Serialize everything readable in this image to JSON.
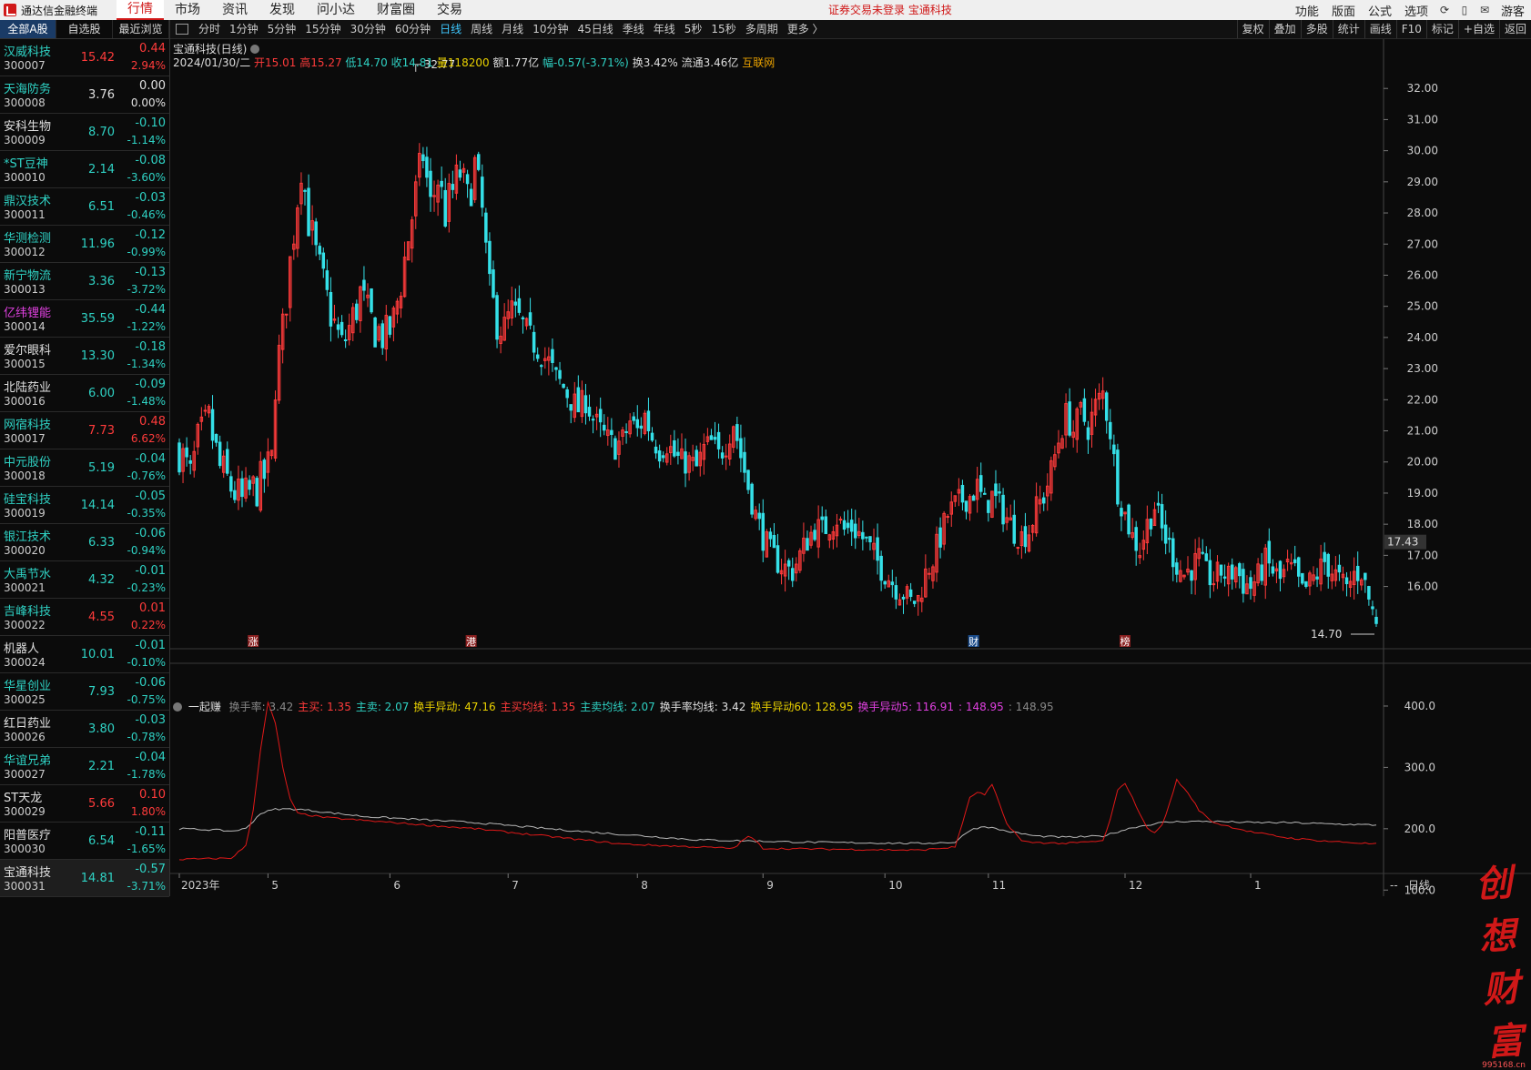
{
  "app": {
    "name": "通达信金融终端"
  },
  "menu": [
    "行情",
    "市场",
    "资讯",
    "发现",
    "问小达",
    "财富圈",
    "交易"
  ],
  "menu_active": 0,
  "notice": "证券交易未登录  宝通科技",
  "right_menu": [
    "功能",
    "版面",
    "公式",
    "选项"
  ],
  "right_icons": [
    "sync-icon",
    "phone-icon",
    "mail-icon"
  ],
  "guest": "游客",
  "left_tabs": [
    "全部A股",
    "自选股",
    "最近浏览"
  ],
  "stocks": [
    {
      "name": "汉威科技",
      "code": "300007",
      "price": "15.42",
      "chg": "0.44",
      "pct": "2.94%",
      "dir": "up",
      "ncolor": "#2fd2c4"
    },
    {
      "name": "天海防务",
      "code": "300008",
      "price": "3.76",
      "chg": "0.00",
      "pct": "0.00%",
      "dir": "fl",
      "ncolor": "#2fd2c4"
    },
    {
      "name": "安科生物",
      "code": "300009",
      "price": "8.70",
      "chg": "-0.10",
      "pct": "-1.14%",
      "dir": "dn",
      "ncolor": "#e0e0e0"
    },
    {
      "name": "*ST豆神",
      "code": "300010",
      "price": "2.14",
      "chg": "-0.08",
      "pct": "-3.60%",
      "dir": "dn",
      "ncolor": "#2fd2c4"
    },
    {
      "name": "鼎汉技术",
      "code": "300011",
      "price": "6.51",
      "chg": "-0.03",
      "pct": "-0.46%",
      "dir": "dn",
      "ncolor": "#2fd2c4"
    },
    {
      "name": "华测检测",
      "code": "300012",
      "price": "11.96",
      "chg": "-0.12",
      "pct": "-0.99%",
      "dir": "dn",
      "ncolor": "#2fd2c4"
    },
    {
      "name": "新宁物流",
      "code": "300013",
      "price": "3.36",
      "chg": "-0.13",
      "pct": "-3.72%",
      "dir": "dn",
      "ncolor": "#2fd2c4"
    },
    {
      "name": "亿纬锂能",
      "code": "300014",
      "price": "35.59",
      "chg": "-0.44",
      "pct": "-1.22%",
      "dir": "dn",
      "ncolor": "#e040e0"
    },
    {
      "name": "爱尔眼科",
      "code": "300015",
      "price": "13.30",
      "chg": "-0.18",
      "pct": "-1.34%",
      "dir": "dn",
      "ncolor": "#e0e0e0"
    },
    {
      "name": "北陆药业",
      "code": "300016",
      "price": "6.00",
      "chg": "-0.09",
      "pct": "-1.48%",
      "dir": "dn",
      "ncolor": "#e0e0e0"
    },
    {
      "name": "网宿科技",
      "code": "300017",
      "price": "7.73",
      "chg": "0.48",
      "pct": "6.62%",
      "dir": "up",
      "ncolor": "#2fd2c4"
    },
    {
      "name": "中元股份",
      "code": "300018",
      "price": "5.19",
      "chg": "-0.04",
      "pct": "-0.76%",
      "dir": "dn",
      "ncolor": "#2fd2c4"
    },
    {
      "name": "硅宝科技",
      "code": "300019",
      "price": "14.14",
      "chg": "-0.05",
      "pct": "-0.35%",
      "dir": "dn",
      "ncolor": "#2fd2c4"
    },
    {
      "name": "银江技术",
      "code": "300020",
      "price": "6.33",
      "chg": "-0.06",
      "pct": "-0.94%",
      "dir": "dn",
      "ncolor": "#2fd2c4"
    },
    {
      "name": "大禹节水",
      "code": "300021",
      "price": "4.32",
      "chg": "-0.01",
      "pct": "-0.23%",
      "dir": "dn",
      "ncolor": "#2fd2c4"
    },
    {
      "name": "吉峰科技",
      "code": "300022",
      "price": "4.55",
      "chg": "0.01",
      "pct": "0.22%",
      "dir": "up",
      "ncolor": "#2fd2c4"
    },
    {
      "name": "机器人",
      "code": "300024",
      "price": "10.01",
      "chg": "-0.01",
      "pct": "-0.10%",
      "dir": "dn",
      "ncolor": "#e0e0e0"
    },
    {
      "name": "华星创业",
      "code": "300025",
      "price": "7.93",
      "chg": "-0.06",
      "pct": "-0.75%",
      "dir": "dn",
      "ncolor": "#2fd2c4"
    },
    {
      "name": "红日药业",
      "code": "300026",
      "price": "3.80",
      "chg": "-0.03",
      "pct": "-0.78%",
      "dir": "dn",
      "ncolor": "#e0e0e0"
    },
    {
      "name": "华谊兄弟",
      "code": "300027",
      "price": "2.21",
      "chg": "-0.04",
      "pct": "-1.78%",
      "dir": "dn",
      "ncolor": "#2fd2c4"
    },
    {
      "name": "ST天龙",
      "code": "300029",
      "price": "5.66",
      "chg": "0.10",
      "pct": "1.80%",
      "dir": "up",
      "ncolor": "#e0e0e0"
    },
    {
      "name": "阳普医疗",
      "code": "300030",
      "price": "6.54",
      "chg": "-0.11",
      "pct": "-1.65%",
      "dir": "dn",
      "ncolor": "#e0e0e0"
    },
    {
      "name": "宝通科技",
      "code": "300031",
      "price": "14.81",
      "chg": "-0.57",
      "pct": "-3.71%",
      "dir": "dn",
      "ncolor": "#e0e0e0",
      "sel": true
    }
  ],
  "toolbar_left": [
    "分时",
    "1分钟",
    "5分钟",
    "15分钟",
    "30分钟",
    "60分钟",
    "日线",
    "周线",
    "月线",
    "10分钟",
    "45日线",
    "季线",
    "年线",
    "5秒",
    "15秒",
    "多周期",
    "更多 〉"
  ],
  "toolbar_active": "日线",
  "toolbar_right": [
    "复权",
    "叠加",
    "多股",
    "统计",
    "画线",
    "F10",
    "标记",
    "+自选",
    "返回"
  ],
  "chart_title": "宝通科技(日线)",
  "info": {
    "date": "2024/01/30/二",
    "open": "开15.01",
    "high": "高15.27",
    "low": "低14.70",
    "close": "收14.81",
    "vol": "量118200",
    "amt": "额1.77亿",
    "amp": "幅-0.57(-3.71%)",
    "turnover": "换3.42%",
    "float": "流通3.46亿",
    "tag": "互联网"
  },
  "indicator": {
    "name": "一起赚",
    "items": [
      {
        "t": "换手率: 3.42",
        "c": "#888888"
      },
      {
        "t": "主买: 1.35",
        "c": "#ff3b3b"
      },
      {
        "t": "主卖: 2.07",
        "c": "#2fd2c4"
      },
      {
        "t": "换手异动: 47.16",
        "c": "#e8d000"
      },
      {
        "t": "主买均线: 1.35",
        "c": "#ff3b3b"
      },
      {
        "t": "主卖均线: 2.07",
        "c": "#2fd2c4"
      },
      {
        "t": "换手率均线: 3.42",
        "c": "#e0e0e0"
      },
      {
        "t": "换手异动60: 128.95",
        "c": "#e8d000"
      },
      {
        "t": "换手异动5: 116.91",
        "c": "#e040e0"
      },
      {
        "t": ": 148.95",
        "c": "#e040e0"
      },
      {
        "t": ": 148.95",
        "c": "#888888"
      }
    ]
  },
  "markers": [
    {
      "label": "涨",
      "index": 20
    },
    {
      "label": "港",
      "index": 79
    },
    {
      "label": "财",
      "index": 215
    },
    {
      "label": "榜",
      "index": 256
    }
  ],
  "watermark": {
    "text": "创想财富",
    "sub": "995168.cn"
  },
  "chart_data": [
    {
      "type": "candlestick",
      "series_name": "宝通科技(日线)",
      "ylim": [
        14.0,
        33.0
      ],
      "yticks": [
        16,
        17,
        18,
        19,
        20,
        21,
        22,
        23,
        24,
        25,
        26,
        27,
        28,
        29,
        30,
        31,
        32
      ],
      "current_price": "17.43",
      "annotations": [
        {
          "text": "32.77",
          "value": 32.77
        },
        {
          "text": "14.70",
          "value": 14.7
        }
      ],
      "xticks": [
        {
          "label": "2023年",
          "index": 0
        },
        {
          "label": "5",
          "index": 24
        },
        {
          "label": "6",
          "index": 57
        },
        {
          "label": "7",
          "index": 89
        },
        {
          "label": "8",
          "index": 124
        },
        {
          "label": "9",
          "index": 158
        },
        {
          "label": "10",
          "index": 191
        },
        {
          "label": "11",
          "index": 219
        },
        {
          "label": "12",
          "index": 256
        },
        {
          "label": "1",
          "index": 290
        }
      ],
      "count": 325,
      "path": [
        [
          0,
          20.4
        ],
        [
          3,
          19.5
        ],
        [
          5,
          20.6
        ],
        [
          8,
          21.3
        ],
        [
          11,
          19.8
        ],
        [
          14,
          19.2
        ],
        [
          17,
          18.7
        ],
        [
          19,
          19.0
        ],
        [
          22,
          19.3
        ],
        [
          25,
          20.0
        ],
        [
          26,
          22.6
        ],
        [
          28,
          24.2
        ],
        [
          30,
          26.4
        ],
        [
          32,
          28.5
        ],
        [
          33,
          29.6
        ],
        [
          35,
          27.8
        ],
        [
          37,
          26.6
        ],
        [
          40,
          25.2
        ],
        [
          42,
          24.4
        ],
        [
          44,
          23.7
        ],
        [
          47,
          24.6
        ],
        [
          49,
          25.4
        ],
        [
          51,
          24.7
        ],
        [
          53,
          24.3
        ],
        [
          56,
          24.0
        ],
        [
          58,
          24.5
        ],
        [
          60,
          25.8
        ],
        [
          62,
          27.2
        ],
        [
          64,
          28.6
        ],
        [
          66,
          29.9
        ],
        [
          68,
          28.2
        ],
        [
          70,
          29.1
        ],
        [
          72,
          28.0
        ],
        [
          74,
          28.7
        ],
        [
          76,
          29.3
        ],
        [
          78,
          28.4
        ],
        [
          80,
          29.5
        ],
        [
          82,
          28.0
        ],
        [
          84,
          25.4
        ],
        [
          86,
          24.6
        ],
        [
          88,
          24.2
        ],
        [
          90,
          24.9
        ],
        [
          92,
          24.6
        ],
        [
          94,
          24.2
        ],
        [
          96,
          23.8
        ],
        [
          98,
          23.5
        ],
        [
          100,
          23.2
        ],
        [
          102,
          22.7
        ],
        [
          104,
          22.4
        ],
        [
          106,
          22.0
        ],
        [
          108,
          21.7
        ],
        [
          110,
          22.0
        ],
        [
          112,
          21.4
        ],
        [
          114,
          21.0
        ],
        [
          116,
          20.7
        ],
        [
          118,
          20.5
        ],
        [
          120,
          20.7
        ],
        [
          122,
          21.3
        ],
        [
          124,
          21.0
        ],
        [
          126,
          21.5
        ],
        [
          128,
          20.8
        ],
        [
          130,
          20.4
        ],
        [
          132,
          20.6
        ],
        [
          134,
          20.2
        ],
        [
          136,
          20.0
        ],
        [
          138,
          20.0
        ],
        [
          140,
          19.8
        ],
        [
          142,
          20.4
        ],
        [
          144,
          20.6
        ],
        [
          146,
          20.2
        ],
        [
          148,
          20.6
        ],
        [
          150,
          21.3
        ],
        [
          152,
          20.2
        ],
        [
          154,
          19.2
        ],
        [
          156,
          18.3
        ],
        [
          158,
          17.6
        ],
        [
          160,
          17.1
        ],
        [
          162,
          16.8
        ],
        [
          164,
          16.6
        ],
        [
          166,
          16.5
        ],
        [
          168,
          17.0
        ],
        [
          170,
          17.5
        ],
        [
          172,
          17.9
        ],
        [
          174,
          17.8
        ],
        [
          176,
          18.0
        ],
        [
          178,
          18.2
        ],
        [
          180,
          17.8
        ],
        [
          182,
          17.9
        ],
        [
          184,
          17.7
        ],
        [
          186,
          17.4
        ],
        [
          188,
          17.0
        ],
        [
          190,
          16.6
        ],
        [
          192,
          16.3
        ],
        [
          194,
          16.0
        ],
        [
          196,
          15.8
        ],
        [
          198,
          15.5
        ],
        [
          200,
          15.6
        ],
        [
          202,
          16.4
        ],
        [
          204,
          16.9
        ],
        [
          206,
          17.6
        ],
        [
          208,
          18.3
        ],
        [
          210,
          18.6
        ],
        [
          212,
          18.8
        ],
        [
          214,
          18.9
        ],
        [
          216,
          19.2
        ],
        [
          218,
          18.6
        ],
        [
          220,
          18.9
        ],
        [
          222,
          18.6
        ],
        [
          224,
          18.2
        ],
        [
          226,
          17.8
        ],
        [
          228,
          17.6
        ],
        [
          230,
          17.8
        ],
        [
          232,
          18.5
        ],
        [
          234,
          18.9
        ],
        [
          236,
          19.7
        ],
        [
          238,
          20.7
        ],
        [
          240,
          21.5
        ],
        [
          242,
          21.0
        ],
        [
          244,
          21.6
        ],
        [
          246,
          21.1
        ],
        [
          248,
          21.8
        ],
        [
          250,
          22.2
        ],
        [
          252,
          21.0
        ],
        [
          254,
          19.1
        ],
        [
          256,
          18.3
        ],
        [
          258,
          17.6
        ],
        [
          260,
          17.2
        ],
        [
          262,
          18.0
        ],
        [
          264,
          18.6
        ],
        [
          266,
          17.8
        ],
        [
          268,
          17.3
        ],
        [
          270,
          16.7
        ],
        [
          272,
          16.4
        ],
        [
          274,
          16.6
        ],
        [
          276,
          16.9
        ],
        [
          278,
          16.4
        ],
        [
          280,
          16.2
        ],
        [
          282,
          16.5
        ],
        [
          284,
          16.3
        ],
        [
          286,
          16.6
        ],
        [
          288,
          16.1
        ],
        [
          290,
          16.0
        ],
        [
          292,
          16.3
        ],
        [
          294,
          16.8
        ],
        [
          296,
          16.5
        ],
        [
          298,
          16.2
        ],
        [
          300,
          16.6
        ],
        [
          302,
          16.4
        ],
        [
          304,
          15.8
        ],
        [
          306,
          16.1
        ],
        [
          308,
          16.4
        ],
        [
          310,
          16.8
        ],
        [
          312,
          16.5
        ],
        [
          314,
          16.2
        ],
        [
          316,
          15.9
        ],
        [
          318,
          16.4
        ],
        [
          320,
          16.5
        ],
        [
          322,
          15.6
        ],
        [
          324,
          14.81
        ]
      ]
    },
    {
      "type": "line",
      "series_names": [
        "换手异动",
        "换手率均线"
      ],
      "ylim": [
        90,
        440
      ],
      "yticks": [
        100,
        200,
        300,
        400
      ],
      "count": 325,
      "red_path": [
        [
          0,
          150
        ],
        [
          14,
          152
        ],
        [
          18,
          172
        ],
        [
          20,
          230
        ],
        [
          22,
          330
        ],
        [
          24,
          405
        ],
        [
          26,
          372
        ],
        [
          28,
          300
        ],
        [
          30,
          248
        ],
        [
          32,
          225
        ],
        [
          40,
          218
        ],
        [
          80,
          200
        ],
        [
          120,
          175
        ],
        [
          150,
          168
        ],
        [
          152,
          178
        ],
        [
          154,
          188
        ],
        [
          156,
          180
        ],
        [
          158,
          168
        ],
        [
          200,
          165
        ],
        [
          210,
          170
        ],
        [
          212,
          210
        ],
        [
          214,
          250
        ],
        [
          216,
          260
        ],
        [
          218,
          255
        ],
        [
          220,
          272
        ],
        [
          222,
          240
        ],
        [
          224,
          208
        ],
        [
          226,
          195
        ],
        [
          228,
          180
        ],
        [
          230,
          178
        ],
        [
          240,
          176
        ],
        [
          250,
          180
        ],
        [
          252,
          215
        ],
        [
          254,
          262
        ],
        [
          256,
          275
        ],
        [
          258,
          250
        ],
        [
          260,
          225
        ],
        [
          262,
          200
        ],
        [
          264,
          195
        ],
        [
          266,
          205
        ],
        [
          268,
          240
        ],
        [
          270,
          280
        ],
        [
          272,
          265
        ],
        [
          274,
          250
        ],
        [
          276,
          230
        ],
        [
          280,
          210
        ],
        [
          290,
          195
        ],
        [
          300,
          185
        ],
        [
          310,
          180
        ],
        [
          324,
          175
        ]
      ],
      "grey_path": [
        [
          0,
          200
        ],
        [
          10,
          198
        ],
        [
          14,
          196
        ],
        [
          18,
          200
        ],
        [
          22,
          225
        ],
        [
          26,
          232
        ],
        [
          32,
          232
        ],
        [
          50,
          220
        ],
        [
          80,
          210
        ],
        [
          110,
          195
        ],
        [
          140,
          182
        ],
        [
          170,
          178
        ],
        [
          200,
          176
        ],
        [
          210,
          178
        ],
        [
          214,
          198
        ],
        [
          218,
          204
        ],
        [
          224,
          196
        ],
        [
          232,
          188
        ],
        [
          240,
          186
        ],
        [
          250,
          188
        ],
        [
          258,
          202
        ],
        [
          266,
          210
        ],
        [
          272,
          212
        ],
        [
          280,
          212
        ],
        [
          290,
          210
        ],
        [
          300,
          210
        ],
        [
          310,
          208
        ],
        [
          324,
          206
        ]
      ]
    }
  ]
}
